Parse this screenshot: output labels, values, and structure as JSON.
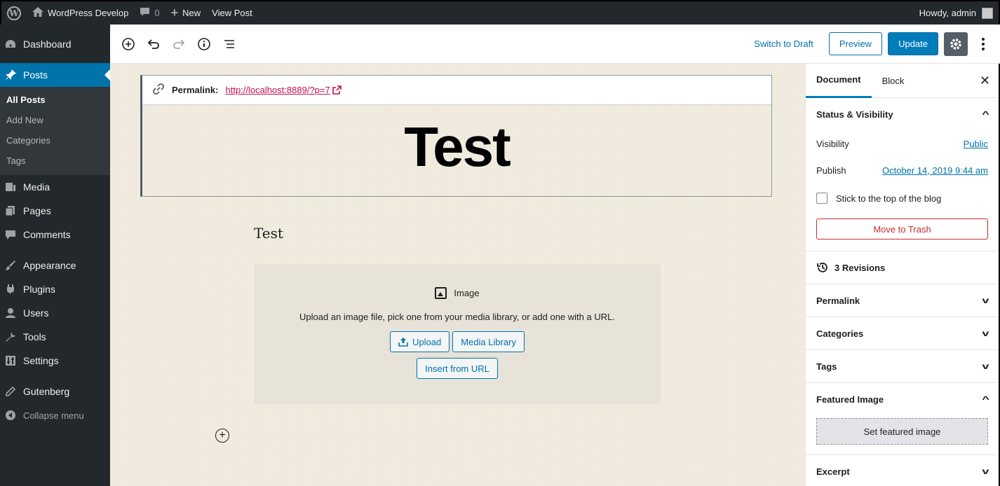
{
  "admin_bar": {
    "site_name": "WordPress Develop",
    "comments_count": "0",
    "new_label": "New",
    "view_post_label": "View Post",
    "howdy": "Howdy, admin"
  },
  "sidebar": {
    "dashboard": "Dashboard",
    "posts": "Posts",
    "submenu": {
      "all_posts": "All Posts",
      "add_new": "Add New",
      "categories": "Categories",
      "tags": "Tags"
    },
    "media": "Media",
    "pages": "Pages",
    "comments": "Comments",
    "appearance": "Appearance",
    "plugins": "Plugins",
    "users": "Users",
    "tools": "Tools",
    "settings": "Settings",
    "gutenberg": "Gutenberg",
    "collapse": "Collapse menu"
  },
  "toolbar": {
    "switch_to_draft": "Switch to Draft",
    "preview": "Preview",
    "update": "Update"
  },
  "editor": {
    "permalink_label": "Permalink:",
    "permalink_url": "http://localhost:8889/?p=7",
    "title": "Test",
    "paragraph": "Test",
    "image_block": {
      "title": "Image",
      "description": "Upload an image file, pick one from your media library, or add one with a URL.",
      "upload": "Upload",
      "media_library": "Media Library",
      "insert_from_url": "Insert from URL"
    }
  },
  "panel": {
    "tabs": {
      "document": "Document",
      "block": "Block"
    },
    "status_visibility": {
      "title": "Status & Visibility",
      "visibility_label": "Visibility",
      "visibility_value": "Public",
      "publish_label": "Publish",
      "publish_value": "October 14, 2019 9:44 am",
      "sticky_label": "Stick to the top of the blog",
      "trash": "Move to Trash"
    },
    "revisions": "3 Revisions",
    "permalink": "Permalink",
    "categories": "Categories",
    "tags": "Tags",
    "featured_image": "Featured Image",
    "set_featured_image": "Set featured image",
    "excerpt": "Excerpt"
  },
  "colors": {
    "admin_dark": "#23282d",
    "accent": "#0073aa",
    "trash": "#c92c2c",
    "canvas": "#f3eee3"
  }
}
